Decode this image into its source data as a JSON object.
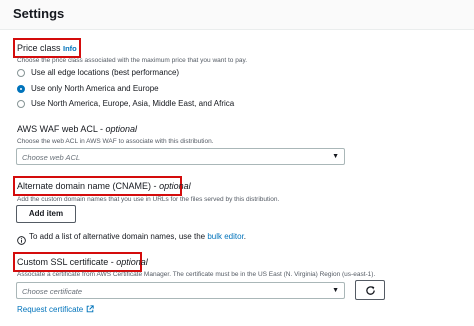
{
  "header": {
    "title": "Settings"
  },
  "price_class": {
    "label": "Price class",
    "info": "Info",
    "description": "Choose the price class associated with the maximum price that you want to pay.",
    "options": [
      {
        "label": "Use all edge locations (best performance)",
        "selected": false
      },
      {
        "label": "Use only North America and Europe",
        "selected": true
      },
      {
        "label": "Use North America, Europe, Asia, Middle East, and Africa",
        "selected": false
      }
    ]
  },
  "waf": {
    "label_prefix": "AWS WAF web ACL - ",
    "label_optional": "optional",
    "description": "Choose the web ACL in AWS WAF to associate with this distribution.",
    "placeholder": "Choose web ACL"
  },
  "cname": {
    "label_prefix": "Alternate domain name (CNAME) - ",
    "label_optional": "optional",
    "description": "Add the custom domain names that you use in URLs for the files served by this distribution.",
    "add_button": "Add item",
    "note_prefix": "To add a list of alternative domain names, use the ",
    "note_link": "bulk editor",
    "note_suffix": "."
  },
  "ssl": {
    "label_prefix": "Custom SSL certificate - ",
    "label_optional": "optional",
    "description": "Associate a certificate from AWS Certificate Manager. The certificate must be in the US East (N. Virginia) Region (us-east-1).",
    "placeholder": "Choose certificate",
    "request_link": "Request certificate"
  },
  "icons": {
    "caret": "caret-down-icon",
    "refresh": "refresh-icon",
    "info": "info-icon",
    "external": "external-link-icon"
  },
  "colors": {
    "accent": "#0073bb",
    "highlight": "#d40c0c"
  }
}
